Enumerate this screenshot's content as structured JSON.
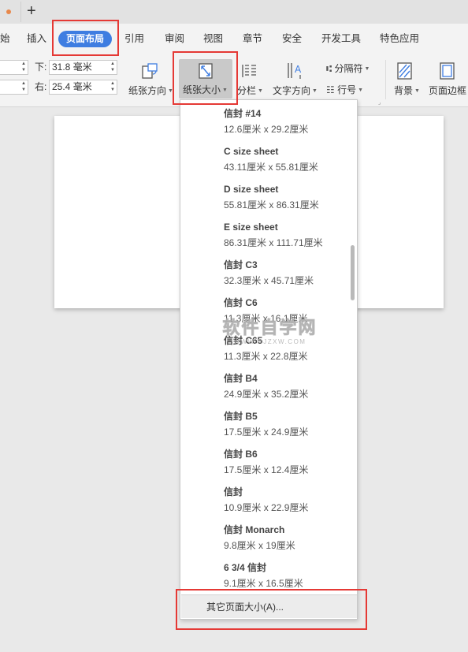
{
  "tabbar": {
    "new_tab_label": "+"
  },
  "menu": {
    "items": [
      "始",
      "插入",
      "页面布局",
      "引用",
      "审阅",
      "视图",
      "章节",
      "安全",
      "开发工具",
      "特色应用"
    ],
    "active": "页面布局",
    "accent_color": "#3e7de1"
  },
  "ribbon": {
    "margins": {
      "bottom_label": "下:",
      "bottom_value": "31.8 毫米",
      "right_label": "右:",
      "right_value": "25.4 毫米"
    },
    "buttons": {
      "orientation": "纸张方向",
      "paper_size": "纸张大小",
      "columns": "分栏",
      "text_direction": "文字方向",
      "breaks": "分隔符",
      "line_numbers": "行号",
      "background": "背景",
      "page_border": "页面边框"
    }
  },
  "paper_sizes": [
    {
      "name": "信封 #14",
      "dims": "12.6厘米  x  29.2厘米"
    },
    {
      "name": "C size sheet",
      "dims": "43.11厘米  x  55.81厘米"
    },
    {
      "name": "D size sheet",
      "dims": "55.81厘米  x  86.31厘米"
    },
    {
      "name": "E size sheet",
      "dims": "86.31厘米  x  111.71厘米"
    },
    {
      "name": "信封 C3",
      "dims": "32.3厘米  x  45.71厘米"
    },
    {
      "name": "信封 C6",
      "dims": "11.3厘米  x  16.1厘米"
    },
    {
      "name": "信封 C65",
      "dims": "11.3厘米  x  22.8厘米"
    },
    {
      "name": "信封 B4",
      "dims": "24.9厘米  x  35.2厘米"
    },
    {
      "name": "信封 B5",
      "dims": "17.5厘米  x  24.9厘米"
    },
    {
      "name": "信封 B6",
      "dims": "17.5厘米  x  12.4厘米"
    },
    {
      "name": "信封",
      "dims": "10.9厘米  x  22.9厘米"
    },
    {
      "name": "信封 Monarch",
      "dims": "9.8厘米  x  19厘米"
    },
    {
      "name": "6 3/4 信封",
      "dims": "9.1厘米  x  16.5厘米"
    }
  ],
  "dropdown_footer": "其它页面大小(A)...",
  "watermark": {
    "main": "软件自学网",
    "sub": "WWW.RJZXW.COM"
  },
  "highlight_color": "#e53935"
}
